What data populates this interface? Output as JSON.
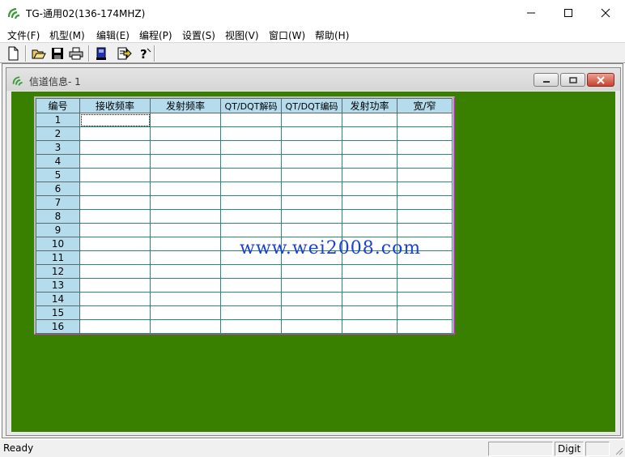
{
  "window": {
    "title": "TG-通用02(136-174MHZ)"
  },
  "menu": [
    {
      "label": "文件(F)"
    },
    {
      "label": "机型(M)"
    },
    {
      "label": "编辑(E)"
    },
    {
      "label": "编程(P)"
    },
    {
      "label": "设置(S)"
    },
    {
      "label": "视图(V)"
    },
    {
      "label": "窗口(W)"
    },
    {
      "label": "帮助(H)"
    }
  ],
  "toolbar": [
    {
      "icon": "new-file-icon"
    },
    {
      "icon": "open-folder-icon"
    },
    {
      "icon": "save-icon"
    },
    {
      "icon": "print-icon"
    },
    {
      "icon": "read-from-radio-icon"
    },
    {
      "icon": "write-to-radio-icon"
    },
    {
      "icon": "help-icon"
    }
  ],
  "child_window": {
    "title": "信道信息- 1"
  },
  "grid": {
    "columns": [
      "编号",
      "接收频率",
      "发射频率",
      "QT/DQT解码",
      "QT/DQT编码",
      "发射功率",
      "宽/窄"
    ],
    "rows": [
      {
        "num": "1",
        "cells": [
          "",
          "",
          "",
          "",
          "",
          ""
        ]
      },
      {
        "num": "2",
        "cells": [
          "",
          "",
          "",
          "",
          "",
          ""
        ]
      },
      {
        "num": "3",
        "cells": [
          "",
          "",
          "",
          "",
          "",
          ""
        ]
      },
      {
        "num": "4",
        "cells": [
          "",
          "",
          "",
          "",
          "",
          ""
        ]
      },
      {
        "num": "5",
        "cells": [
          "",
          "",
          "",
          "",
          "",
          ""
        ]
      },
      {
        "num": "6",
        "cells": [
          "",
          "",
          "",
          "",
          "",
          ""
        ]
      },
      {
        "num": "7",
        "cells": [
          "",
          "",
          "",
          "",
          "",
          ""
        ]
      },
      {
        "num": "8",
        "cells": [
          "",
          "",
          "",
          "",
          "",
          ""
        ]
      },
      {
        "num": "9",
        "cells": [
          "",
          "",
          "",
          "",
          "",
          ""
        ]
      },
      {
        "num": "10",
        "cells": [
          "",
          "",
          "",
          "",
          "",
          ""
        ]
      },
      {
        "num": "11",
        "cells": [
          "",
          "",
          "",
          "",
          "",
          ""
        ]
      },
      {
        "num": "12",
        "cells": [
          "",
          "",
          "",
          "",
          "",
          ""
        ]
      },
      {
        "num": "13",
        "cells": [
          "",
          "",
          "",
          "",
          "",
          ""
        ]
      },
      {
        "num": "14",
        "cells": [
          "",
          "",
          "",
          "",
          "",
          ""
        ]
      },
      {
        "num": "15",
        "cells": [
          "",
          "",
          "",
          "",
          "",
          ""
        ]
      },
      {
        "num": "16",
        "cells": [
          "",
          "",
          "",
          "",
          "",
          ""
        ]
      }
    ]
  },
  "watermark": "www.wei2008.com",
  "statusbar": {
    "text": "Ready",
    "indicator": "Digit"
  },
  "colors": {
    "mdi_background": "#3a8000",
    "grid_header": "#b4dcec",
    "grid_lines": "#2a8a7a",
    "watermark": "#1a3fdc",
    "close_button": "#c9422f"
  }
}
